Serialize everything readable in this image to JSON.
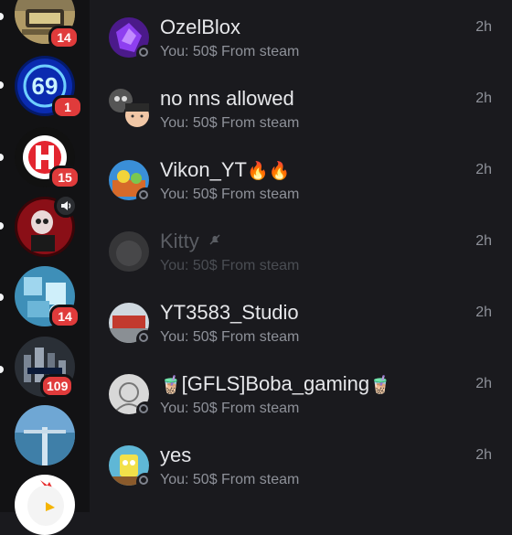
{
  "servers": [
    {
      "icon": "golden-chest-server-icon",
      "badge": "14"
    },
    {
      "icon": "neon-69-server-icon",
      "badge": "1"
    },
    {
      "icon": "hyper-h-logo-server-icon",
      "badge": "15"
    },
    {
      "icon": "red-skull-server-icon",
      "speaker_icon": "speaker-icon"
    },
    {
      "icon": "blue-crystal-server-icon",
      "badge": "14"
    },
    {
      "icon": "hyper-city-server-icon",
      "badge": "109"
    },
    {
      "icon": "ocean-pier-server-icon"
    },
    {
      "icon": "chicken-server-icon"
    }
  ],
  "dms": [
    {
      "name": "OzelBlox",
      "preview": "You: 50$ From steam",
      "time": "2h",
      "avatar": "purple-avatar"
    },
    {
      "name": "no nns allowed",
      "preview": "You: 50$ From steam",
      "time": "2h",
      "avatar": "group-avatar"
    },
    {
      "name": "Vikon_YT",
      "name_suffix": "🔥🔥",
      "preview": "You: 50$ From steam",
      "time": "2h",
      "avatar": "game-avatar"
    },
    {
      "name": "Kitty",
      "preview": "You: 50$ From steam",
      "time": "2h",
      "avatar": "kitty-avatar",
      "muted_icon": "bell-off-icon"
    },
    {
      "name": "YT3583_Studio",
      "preview": "You: 50$ From steam",
      "time": "2h",
      "avatar": "studio-avatar"
    },
    {
      "name_prefix": "🧋",
      "name": "[GFLS]Boba_gaming",
      "name_suffix": "🧋",
      "preview": "You: 50$ From steam",
      "time": "2h",
      "avatar": "sketch-avatar"
    },
    {
      "name": "yes",
      "preview": "You: 50$ From steam",
      "time": "2h",
      "avatar": "sponge-avatar"
    }
  ],
  "colors": {
    "rail_bg": "#121214",
    "list_bg": "#1a1a1e",
    "badge_red": "#e03b3b",
    "name_text": "#e6e7ea",
    "muted_text": "#8e9199"
  }
}
